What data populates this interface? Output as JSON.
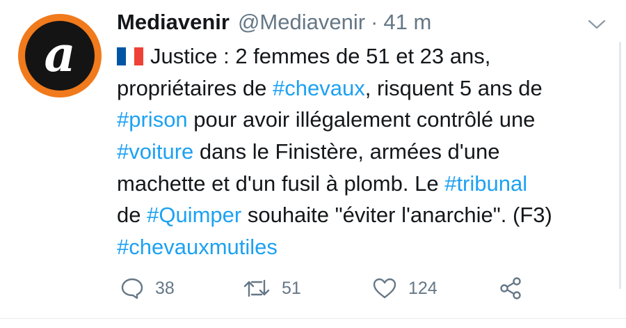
{
  "tweet": {
    "author_name": "Mediavenir",
    "handle": "@Mediavenir",
    "separator": "·",
    "time": "41 m",
    "avatar_letter": "a",
    "flag": "france-flag-emoji",
    "text_lines": [
      {
        "before": "Justice : 2 femmes de 51 et 23 ans,"
      },
      {
        "before": "propriétaires de ",
        "tag": "#chevaux",
        "after": ", risquent 5 ans de"
      },
      {
        "tag": "#prison",
        "after": " pour avoir illégalement contrôlé une"
      },
      {
        "tag": "#voiture",
        "after": " dans le Finistère, armées d'une"
      },
      {
        "before": "machette et d'un fusil à plomb. Le ",
        "tag": "#tribunal"
      },
      {
        "before": "de ",
        "tag": "#Quimper",
        "after": " souhaite \"éviter l'anarchie\". (F3)"
      },
      {
        "tag": "#chevauxmutiles"
      }
    ],
    "actions": {
      "reply_count": "38",
      "retweet_count": "51",
      "like_count": "124"
    }
  },
  "colors": {
    "link": "#1da1f2",
    "text": "#14171a",
    "secondary": "#657786",
    "avatar_ring": "#f07a1c",
    "avatar_bg": "#141414"
  },
  "icons": [
    "chevron-down-icon",
    "reply-icon",
    "retweet-icon",
    "like-icon",
    "share-icon"
  ]
}
